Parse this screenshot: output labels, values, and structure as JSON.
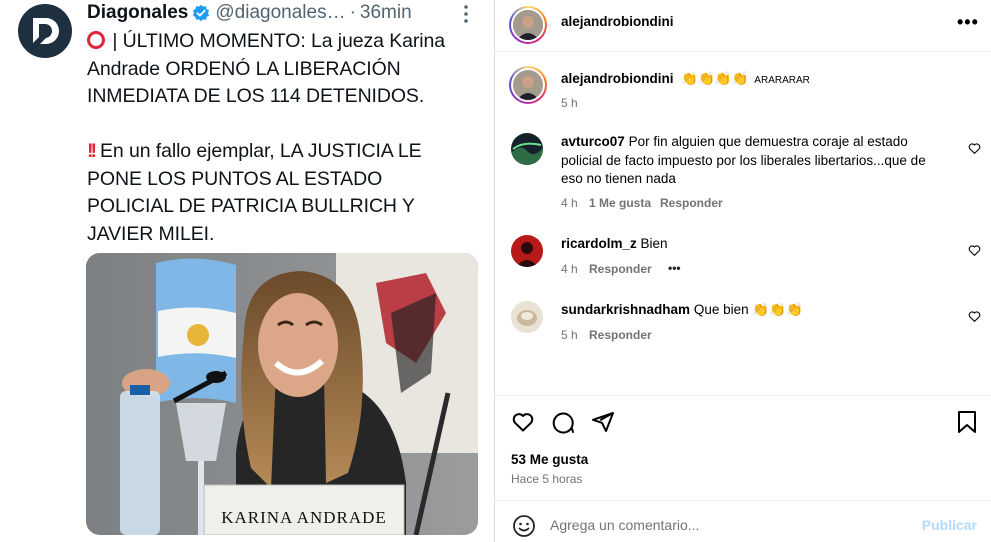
{
  "tweet": {
    "display_name": "Diagonales",
    "handle": "@diagonales…",
    "separator": "·",
    "time": "36min",
    "lines": [
      "| ÚLTIMO MOMENTO: La jueza Karina",
      "Andrade ORDENÓ LA LIBERACIÓN",
      "INMEDIATA DE LOS 114 DETENIDOS.",
      "En un fallo ejemplar, LA JUSTICIA LE",
      "PONE LOS PUNTOS AL ESTADO",
      "POLICIAL DE PATRICIA BULLRICH Y",
      "JAVIER MILEI."
    ],
    "emoji_bang": "!!",
    "photo_nameplate": "KARINA ANDRADE"
  },
  "post": {
    "author": "alejandrobiondini",
    "caption_author": "alejandrobiondini",
    "caption_emoji_count": 4,
    "caption_suffix": "ARARARAR",
    "caption_time": "5 h",
    "comments": [
      {
        "user": "avturco07",
        "text_lines": [
          "Por fin alguien que demuestra coraje al estado",
          "policial de facto impuesto por los liberales libertarios...que de",
          "eso no tienen nada"
        ],
        "time": "4 h",
        "likes": "1 Me gusta",
        "reply": "Responder"
      },
      {
        "user": "ricardolm_z",
        "text": "Bien",
        "time": "4 h",
        "reply": "Responder",
        "more": "•••"
      },
      {
        "user": "sundarkrishnadham",
        "text": "Que bien",
        "emoji_count": 3,
        "time": "5 h",
        "reply": "Responder"
      }
    ],
    "likes": "53 Me gusta",
    "timestamp": "Hace 5 horas",
    "comment_placeholder": "Agrega un comentario...",
    "publish": "Publicar",
    "more_dots": "•••"
  },
  "colors": {
    "ig_link": "#0095f6",
    "publish_disabled": "#b3dbff",
    "muted": "#737373",
    "twitter_blue": "#1d9bf0",
    "red_emoji": "#e0243a"
  }
}
